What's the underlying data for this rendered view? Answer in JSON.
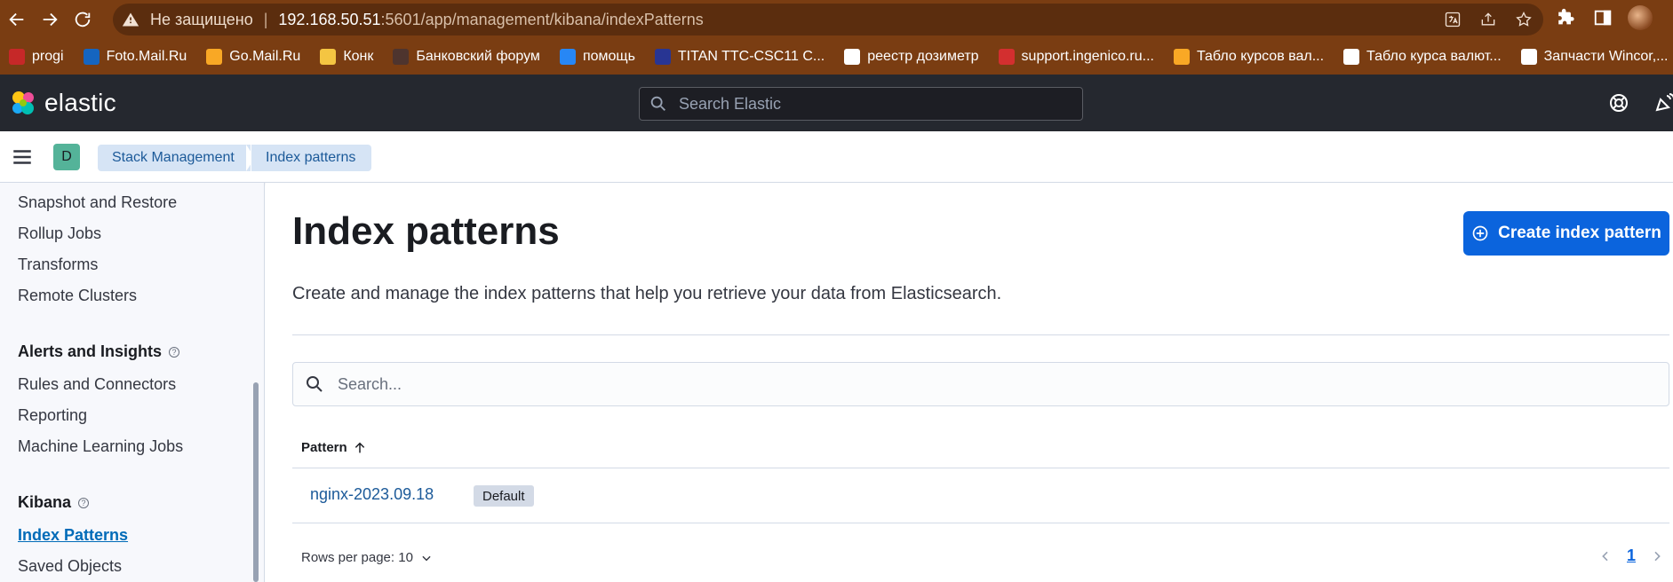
{
  "browser": {
    "insecure_label": "Не защищено",
    "url_host": "192.168.50.51",
    "url_rest": ":5601/app/management/kibana/indexPatterns"
  },
  "bookmarks": [
    {
      "label": "progi",
      "color": "#c62828"
    },
    {
      "label": "Foto.Mail.Ru",
      "color": "#1565c0"
    },
    {
      "label": "Go.Mail.Ru",
      "color": "#f9a825"
    },
    {
      "label": "Конк",
      "color": "#f4c542"
    },
    {
      "label": "Банковский форум",
      "color": "#4e342e"
    },
    {
      "label": "помощь",
      "color": "#2787f5"
    },
    {
      "label": "TITAN TTC-CSC11 C...",
      "color": "#283593"
    },
    {
      "label": "реестр дозиметр",
      "color": "#ffffff"
    },
    {
      "label": "support.ingenico.ru...",
      "color": "#d32f2f"
    },
    {
      "label": "Табло курсов вал...",
      "color": "#f9a825"
    },
    {
      "label": "Табло курса валют...",
      "color": "#ffffff"
    },
    {
      "label": "Запчасти Wincor,...",
      "color": "#ffffff"
    }
  ],
  "header": {
    "logo_text": "elastic",
    "search_placeholder": "Search Elastic"
  },
  "breadcrumbs": {
    "space_initial": "D",
    "items": [
      "Stack Management",
      "Index patterns"
    ]
  },
  "sidenav": {
    "items_top": [
      "Snapshot and Restore",
      "Rollup Jobs",
      "Transforms",
      "Remote Clusters"
    ],
    "section_alerts": "Alerts and Insights",
    "items_alerts": [
      "Rules and Connectors",
      "Reporting",
      "Machine Learning Jobs"
    ],
    "section_kibana": "Kibana",
    "items_kibana": [
      "Index Patterns",
      "Saved Objects"
    ]
  },
  "main": {
    "title": "Index patterns",
    "create_button": "Create index pattern",
    "description": "Create and manage the index patterns that help you retrieve your data from Elasticsearch.",
    "search_placeholder": "Search...",
    "column_pattern": "Pattern",
    "rows": [
      {
        "pattern": "nginx-2023.09.18",
        "badge": "Default"
      }
    ],
    "rows_per_page": "Rows per page: 10",
    "current_page": "1"
  },
  "colors": {
    "browser_chrome": "#7a3d12",
    "kibana_header": "#25282f",
    "primary": "#0b64dd",
    "link": "#1c5a99"
  }
}
